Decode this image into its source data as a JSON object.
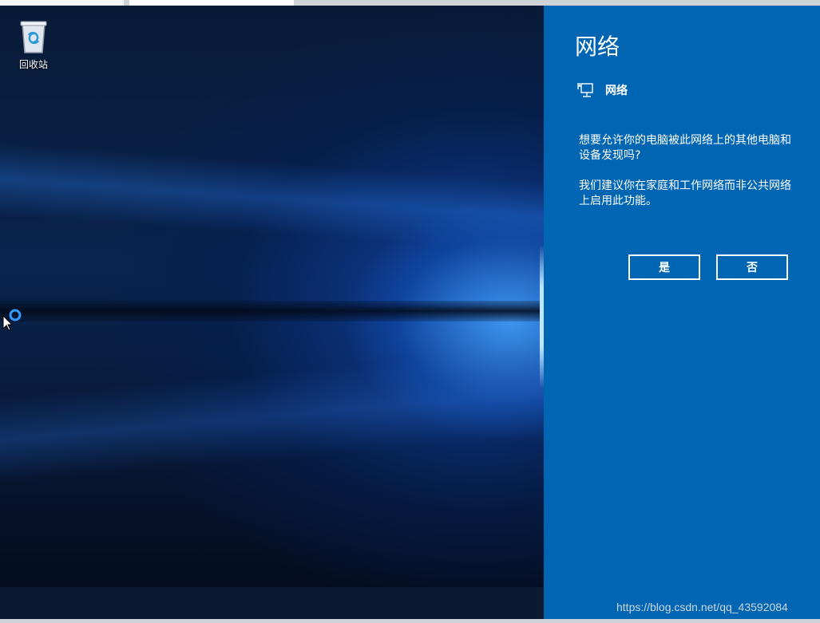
{
  "desktop": {
    "icons": [
      {
        "label": "回收站",
        "icon": "recycle-bin-icon"
      }
    ]
  },
  "taskbar": {
    "items": [
      {
        "icon": "windows-start-icon"
      },
      {
        "icon": "search-icon"
      },
      {
        "icon": "task-view-icon"
      },
      {
        "icon": "internet-explorer-icon"
      },
      {
        "icon": "file-explorer-icon"
      }
    ]
  },
  "network_panel": {
    "title": "网络",
    "network_name": "网络",
    "network_icon": "wired-network-icon",
    "question": "想要允许你的电脑被此网络上的其他电脑和设备发现吗?",
    "recommendation": "我们建议你在家庭和工作网络而非公共网络上启用此功能。",
    "yes_label": "是",
    "no_label": "否",
    "accent_color": "#0066b4"
  },
  "watermark": "https://blog.csdn.net/qq_43592084"
}
